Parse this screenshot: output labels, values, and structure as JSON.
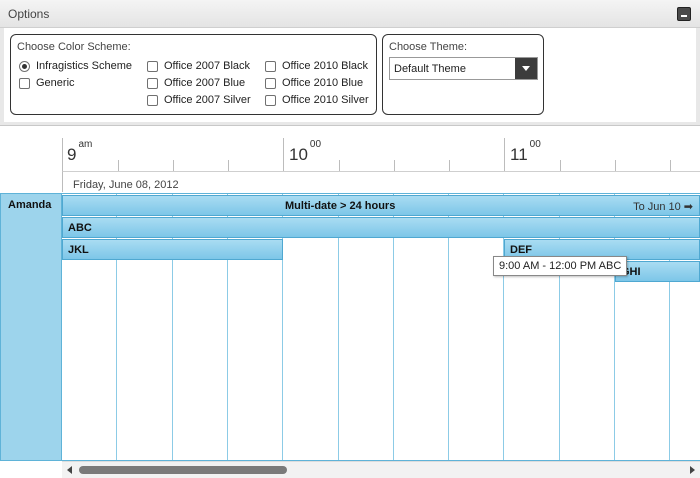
{
  "options": {
    "title": "Options",
    "collapse_icon": "minus-icon"
  },
  "color_scheme": {
    "label": "Choose Color Scheme:",
    "items": [
      {
        "label": "Infragistics Scheme",
        "checked": true
      },
      {
        "label": "Generic",
        "checked": false
      },
      {
        "label": "Office 2007 Black",
        "checked": false
      },
      {
        "label": "Office 2007 Blue",
        "checked": false
      },
      {
        "label": "Office 2007 Silver",
        "checked": false
      },
      {
        "label": "Office 2010 Black",
        "checked": false
      },
      {
        "label": "Office 2010 Blue",
        "checked": false
      },
      {
        "label": "Office 2010 Silver",
        "checked": false
      }
    ]
  },
  "theme": {
    "label": "Choose Theme:",
    "selected": "Default Theme"
  },
  "schedule": {
    "hours": [
      {
        "hour": "9",
        "suffix": "am"
      },
      {
        "hour": "10",
        "suffix": "00"
      },
      {
        "hour": "11",
        "suffix": "00"
      }
    ],
    "date": "Friday, June 08, 2012",
    "resource": "Amanda",
    "appointments": {
      "multidate": "Multi-date > 24 hours",
      "multidate_to": "To Jun 10",
      "abc": "ABC",
      "jkl": "JKL",
      "def": "DEF",
      "ghi": "GHI"
    },
    "tooltip": "9:00 AM - 12:00 PM  ABC"
  },
  "colors": {
    "appointment": "#7dc6e8",
    "resource": "#9dd4ec",
    "grid_line": "#8ccbe6"
  }
}
